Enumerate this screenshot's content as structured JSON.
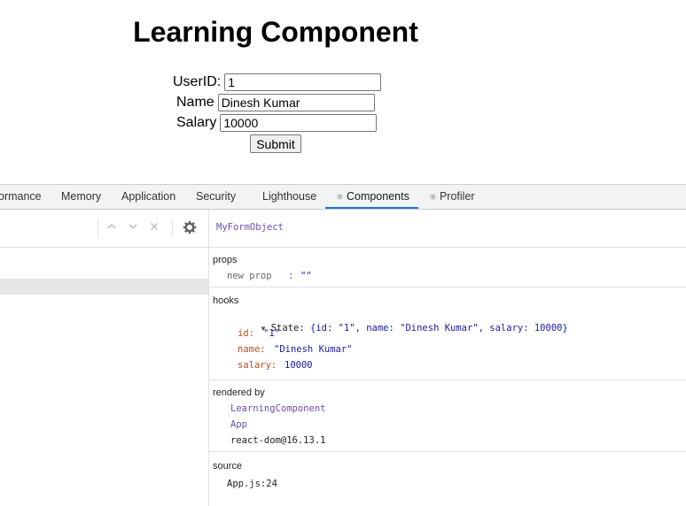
{
  "app": {
    "title": "Learning Component",
    "form": {
      "userid_label": "UserID:",
      "userid_value": "1",
      "name_label": "Name",
      "name_value": "Dinesh Kumar",
      "salary_label": "Salary",
      "salary_value": "10000",
      "submit_label": "Submit"
    }
  },
  "devtools": {
    "tabs": [
      "ormance",
      "Memory",
      "Application",
      "Security",
      "Lighthouse",
      "Components",
      "Profiler"
    ],
    "active_tab": "Components",
    "tab_icons": {
      "components": "atom-icon",
      "profiler": "atom-icon"
    },
    "toolbar_icons": [
      "chevron-up-icon",
      "chevron-down-icon",
      "close-icon",
      "gear-icon"
    ],
    "component": {
      "name": "MyFormObject",
      "props": {
        "title": "props",
        "key": "new prop",
        "colon": ":",
        "value": "\"\""
      },
      "hooks": {
        "title": "hooks",
        "state_label": "State:",
        "state_summary": "{id: \"1\", name: \"Dinesh Kumar\", salary: 10000}",
        "fields": [
          {
            "key": "id:",
            "value": "\"1\""
          },
          {
            "key": "name:",
            "value": "\"Dinesh Kumar\""
          },
          {
            "key": "salary:",
            "value": "10000"
          }
        ]
      },
      "rendered_by": {
        "title": "rendered by",
        "items": [
          "LearningComponent",
          "App",
          "react-dom@16.13.1"
        ]
      },
      "source": {
        "title": "source",
        "file": "App.js:24"
      }
    },
    "colors": {
      "accent": "#1a73e8",
      "component": "#6a51b2",
      "key": "#c14c1e",
      "value": "#1a1aa6"
    }
  }
}
